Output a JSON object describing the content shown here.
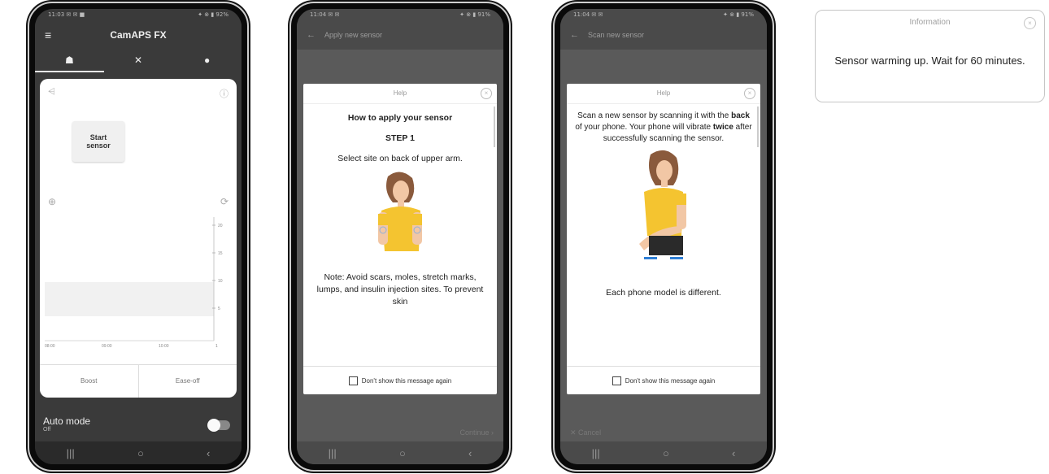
{
  "phone1": {
    "status": {
      "left": "11:03 ✉ ✉ ■",
      "right": "✦ ⊗ ▮ 92%"
    },
    "title": "CamAPS FX",
    "tabs": [
      {
        "icon": "home-icon",
        "glyph": "☗"
      },
      {
        "icon": "tools-icon",
        "glyph": "✕"
      },
      {
        "icon": "drop-icon",
        "glyph": "●"
      }
    ],
    "start_sensor": "Start\nsensor",
    "chart_data": {
      "type": "line",
      "x_ticks": [
        "08:00",
        "09:00",
        "10:00",
        "1"
      ],
      "y_ticks": [
        "20",
        "15",
        "10",
        "5"
      ]
    },
    "boost": "Boost",
    "ease_off": "Ease-off",
    "auto_mode": "Auto mode",
    "auto_mode_state": "Off",
    "nav": [
      "|||",
      "○",
      "‹"
    ]
  },
  "phone2": {
    "status": {
      "left": "11:04 ✉ ✉",
      "right": "✦ ⊗ ▮ 91%"
    },
    "title": "Apply new sensor",
    "dialog_title": "Help",
    "heading": "How to apply your sensor",
    "step": "STEP 1",
    "instruction": "Select site on back of upper arm.",
    "note": "Note: Avoid scars, moles, stretch marks, lumps, and insulin injection sites. To prevent skin",
    "checkbox_label": "Don't show this message again",
    "continue": "Continue",
    "nav": [
      "|||",
      "○",
      "‹"
    ]
  },
  "phone3": {
    "status": {
      "left": "11:04 ✉ ✉",
      "right": "✦ ⊗ ▮ 91%"
    },
    "title": "Scan new sensor",
    "dialog_title": "Help",
    "scan_text_1": "Scan a new sensor by scanning it with the ",
    "scan_bold_1": "back",
    "scan_text_2": " of your phone. Your phone will vibrate ",
    "scan_bold_2": "twice",
    "scan_text_3": " after successfully scanning the sensor.",
    "bottom_text": "Each phone model is different.",
    "checkbox_label": "Don't show this message again",
    "cancel": "Cancel",
    "nav": [
      "|||",
      "○",
      "‹"
    ]
  },
  "info": {
    "title": "Information",
    "message": "Sensor warming up. Wait for 60 minutes."
  }
}
